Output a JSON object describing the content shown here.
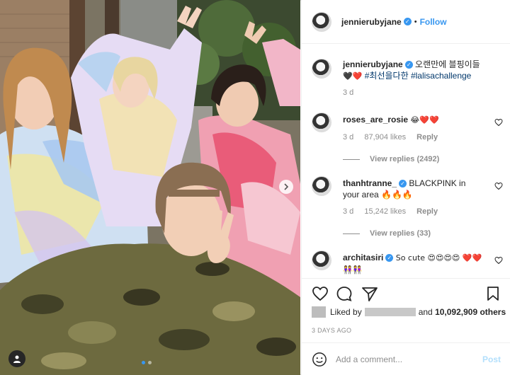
{
  "header": {
    "username": "jennierubyjane",
    "follow_label": "Follow",
    "separator": "•"
  },
  "caption": {
    "username": "jennierubyjane",
    "text_line1": "오랜만에 블핑이들",
    "emojis": "🖤❤️",
    "hashtags": "#최선을다한 #lalisachallenge",
    "time": "3 d"
  },
  "comments": [
    {
      "username": "roses_are_rosie",
      "text": "😂❤️❤️",
      "time": "3 d",
      "likes": "87,904 likes",
      "reply_label": "Reply",
      "view_replies": "View replies (2492)"
    },
    {
      "username": "thanhtranne_",
      "text": "BLACKPINK in your area 🔥🔥🔥",
      "time": "3 d",
      "likes": "15,242 likes",
      "reply_label": "Reply",
      "view_replies": "View replies (33)"
    },
    {
      "username": "architasiri",
      "text": "So cute 😍😍😍😍 ❤️❤️👭👭",
      "verified": true
    }
  ],
  "likes": {
    "prefix": "Liked by",
    "suffix_and": "and",
    "count": "10,092,909 others"
  },
  "timestamp": "3 DAYS AGO",
  "composer": {
    "placeholder": "Add a comment...",
    "post_label": "Post"
  },
  "icons": {
    "heart": "heart-icon",
    "comment": "comment-icon",
    "share": "share-icon",
    "save": "bookmark-icon",
    "emoji": "smiley-icon",
    "next": "chevron-right-icon",
    "tag": "person-tag-icon"
  },
  "colors": {
    "accent": "#3897f0",
    "text": "#262626",
    "muted": "#8e8e8e",
    "post_disabled": "#b2dffc"
  }
}
